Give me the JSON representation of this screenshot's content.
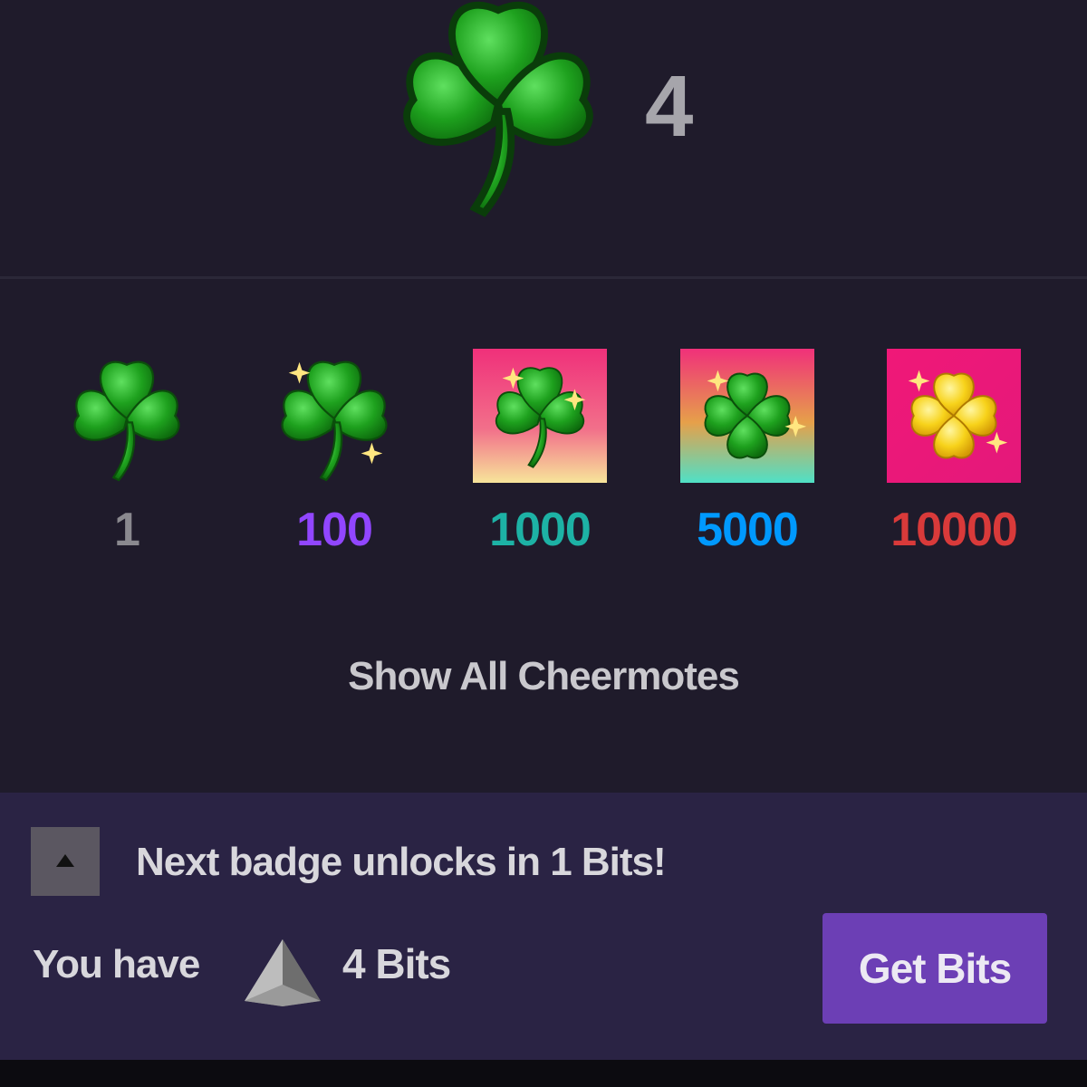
{
  "hero": {
    "amount": "4",
    "icon": "shamrock-icon"
  },
  "tiers": [
    {
      "label": "1",
      "color": "#8a898f",
      "icon": "shamrock-icon",
      "background": "none"
    },
    {
      "label": "100",
      "color": "#9146ff",
      "icon": "sparkle-shamrock-icon",
      "background": "none"
    },
    {
      "label": "1000",
      "color": "#1db2a5",
      "icon": "shamrock-tile-icon",
      "background": "pink-to-yellow"
    },
    {
      "label": "5000",
      "color": "#0099fe",
      "icon": "four-leaf-clover-tile-icon",
      "background": "pink-to-cyan"
    },
    {
      "label": "10000",
      "color": "#d93a3a",
      "icon": "gold-clover-tile-icon",
      "background": "magenta"
    }
  ],
  "show_all": "Show All Cheermotes",
  "footer": {
    "next_badge": "Next badge unlocks in 1 Bits!",
    "you_have": "You have",
    "bits_amount": "4 Bits",
    "get_bits": "Get Bits"
  },
  "colors": {
    "panel": "#1f1b2b",
    "footer": "#2a2344",
    "accent": "#6c3fb5",
    "shamrock_green": "#1fa51f"
  }
}
